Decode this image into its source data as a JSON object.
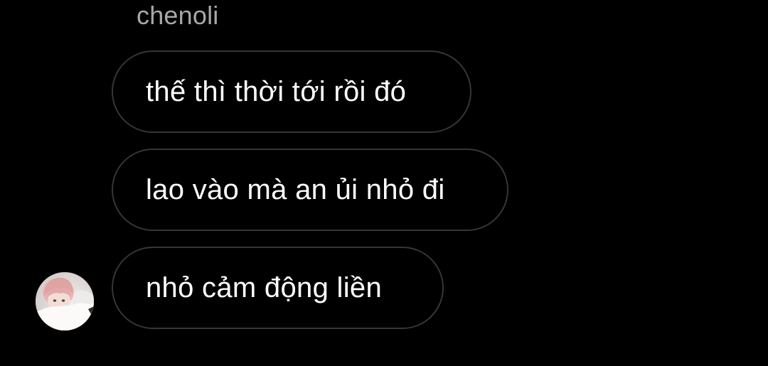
{
  "thread": {
    "sender_name": "chenoli",
    "messages": [
      {
        "text": "thế thì thời tới rồi đó"
      },
      {
        "text": "lao vào mà an ủi nhỏ đi"
      },
      {
        "text": "nhỏ cảm động liền"
      }
    ],
    "avatar_icon": "profile-photo-avatar"
  },
  "colors": {
    "background": "#000000",
    "bubble_border": "#363636",
    "message_text": "#ffffff",
    "sender_name_text": "#a8a8a8"
  }
}
